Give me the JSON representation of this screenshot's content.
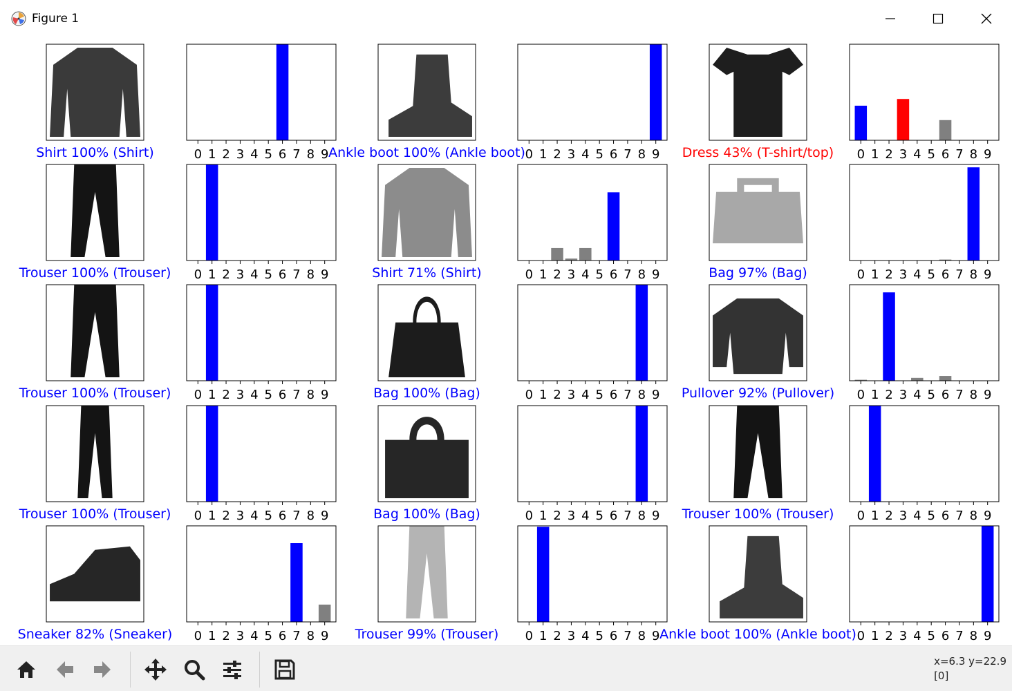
{
  "window": {
    "title": "Figure 1",
    "app_icon": "matplotlib-icon",
    "controls": [
      "minimize-icon",
      "maximize-icon",
      "close-icon"
    ]
  },
  "toolbar": {
    "tools": [
      {
        "name": "home-button",
        "icon": "home-icon"
      },
      {
        "name": "back-button",
        "icon": "arrow-left-icon"
      },
      {
        "name": "forward-button",
        "icon": "arrow-right-icon"
      },
      {
        "name": "pan-button",
        "icon": "move-icon"
      },
      {
        "name": "zoom-button",
        "icon": "magnifier-icon"
      },
      {
        "name": "configure-subplots-button",
        "icon": "sliders-icon"
      },
      {
        "name": "save-button",
        "icon": "floppy-disk-icon"
      }
    ],
    "status_coords": "x=6.3 y=22.9",
    "status_value": "[0]"
  },
  "colors": {
    "correct": "#0000ff",
    "wrong": "#ff0000",
    "other": "#808080"
  },
  "chart_data": {
    "type": "bar",
    "categories": [
      "0",
      "1",
      "2",
      "3",
      "4",
      "5",
      "6",
      "7",
      "8",
      "9"
    ],
    "ylim": [
      0,
      1
    ],
    "grid": false,
    "panels": [
      {
        "caption": "Shirt 100% (Shirt)",
        "status": "correct",
        "image": "shirt",
        "true_label": 6,
        "pred_label": 6,
        "values": [
          0,
          0,
          0,
          0,
          0,
          0,
          1.0,
          0,
          0,
          0
        ]
      },
      {
        "caption": "Ankle boot 100% (Ankle boot)",
        "status": "correct",
        "image": "ankle-boot",
        "true_label": 9,
        "pred_label": 9,
        "values": [
          0,
          0,
          0,
          0,
          0,
          0,
          0,
          0,
          0,
          1.0
        ]
      },
      {
        "caption": "Dress 43% (T-shirt/top)",
        "status": "wrong",
        "image": "tshirt",
        "true_label": 0,
        "pred_label": 3,
        "values": [
          0.36,
          0,
          0,
          0.43,
          0,
          0,
          0.21,
          0,
          0,
          0
        ]
      },
      {
        "caption": "Trouser 100% (Trouser)",
        "status": "correct",
        "image": "trouser",
        "true_label": 1,
        "pred_label": 1,
        "values": [
          0,
          1.0,
          0,
          0,
          0,
          0,
          0,
          0,
          0,
          0
        ]
      },
      {
        "caption": "Shirt 71% (Shirt)",
        "status": "correct",
        "image": "shirt-light",
        "true_label": 6,
        "pred_label": 6,
        "values": [
          0,
          0,
          0.13,
          0.02,
          0.13,
          0,
          0.71,
          0,
          0,
          0
        ]
      },
      {
        "caption": "Bag 97% (Bag)",
        "status": "correct",
        "image": "bag-light",
        "true_label": 8,
        "pred_label": 8,
        "values": [
          0,
          0,
          0,
          0,
          0,
          0,
          0.01,
          0,
          0.97,
          0
        ]
      },
      {
        "caption": "Trouser 100% (Trouser)",
        "status": "correct",
        "image": "trouser",
        "true_label": 1,
        "pred_label": 1,
        "values": [
          0,
          1.0,
          0,
          0,
          0,
          0,
          0,
          0,
          0,
          0
        ]
      },
      {
        "caption": "Bag 100% (Bag)",
        "status": "correct",
        "image": "tote-bag",
        "true_label": 8,
        "pred_label": 8,
        "values": [
          0,
          0,
          0,
          0,
          0,
          0,
          0,
          0,
          1.0,
          0
        ]
      },
      {
        "caption": "Pullover 92% (Pullover)",
        "status": "correct",
        "image": "pullover",
        "true_label": 2,
        "pred_label": 2,
        "values": [
          0.01,
          0,
          0.92,
          0,
          0.03,
          0,
          0.05,
          0,
          0,
          0
        ]
      },
      {
        "caption": "Trouser 100% (Trouser)",
        "status": "correct",
        "image": "trouser-thin",
        "true_label": 1,
        "pred_label": 1,
        "values": [
          0,
          1.0,
          0,
          0,
          0,
          0,
          0,
          0,
          0,
          0
        ]
      },
      {
        "caption": "Bag 100% (Bag)",
        "status": "correct",
        "image": "handbag",
        "true_label": 8,
        "pred_label": 8,
        "values": [
          0,
          0,
          0,
          0,
          0,
          0,
          0,
          0,
          1.0,
          0
        ]
      },
      {
        "caption": "Trouser 100% (Trouser)",
        "status": "correct",
        "image": "trouser",
        "true_label": 1,
        "pred_label": 1,
        "values": [
          0,
          1.0,
          0,
          0,
          0,
          0,
          0,
          0,
          0,
          0
        ]
      },
      {
        "caption": "Sneaker 82% (Sneaker)",
        "status": "correct",
        "image": "sneaker",
        "true_label": 7,
        "pred_label": 7,
        "values": [
          0,
          0,
          0,
          0,
          0,
          0,
          0,
          0.82,
          0,
          0.18
        ]
      },
      {
        "caption": "Trouser 99% (Trouser)",
        "status": "correct",
        "image": "trouser-light",
        "true_label": 1,
        "pred_label": 1,
        "values": [
          0,
          0.99,
          0,
          0,
          0,
          0,
          0,
          0,
          0,
          0
        ]
      },
      {
        "caption": "Ankle boot 100% (Ankle boot)",
        "status": "correct",
        "image": "ankle-boot",
        "true_label": 9,
        "pred_label": 9,
        "values": [
          0,
          0,
          0,
          0,
          0,
          0,
          0,
          0,
          0,
          1.0
        ]
      }
    ]
  }
}
